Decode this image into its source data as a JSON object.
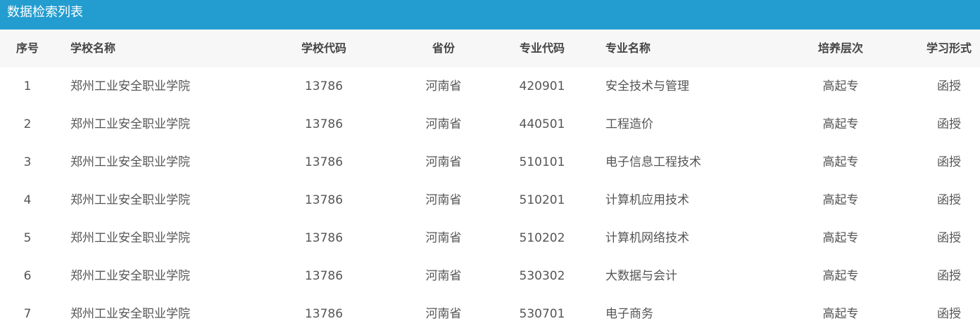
{
  "panel": {
    "title": "数据检索列表"
  },
  "table": {
    "headers": {
      "idx": "序号",
      "school_name": "学校名称",
      "school_code": "学校代码",
      "province": "省份",
      "major_code": "专业代码",
      "major_name": "专业名称",
      "level": "培养层次",
      "study_form": "学习形式"
    },
    "rows": [
      {
        "idx": "1",
        "school_name": "郑州工业安全职业学院",
        "school_code": "13786",
        "province": "河南省",
        "major_code": "420901",
        "major_name": "安全技术与管理",
        "level": "高起专",
        "study_form": "函授"
      },
      {
        "idx": "2",
        "school_name": "郑州工业安全职业学院",
        "school_code": "13786",
        "province": "河南省",
        "major_code": "440501",
        "major_name": "工程造价",
        "level": "高起专",
        "study_form": "函授"
      },
      {
        "idx": "3",
        "school_name": "郑州工业安全职业学院",
        "school_code": "13786",
        "province": "河南省",
        "major_code": "510101",
        "major_name": "电子信息工程技术",
        "level": "高起专",
        "study_form": "函授"
      },
      {
        "idx": "4",
        "school_name": "郑州工业安全职业学院",
        "school_code": "13786",
        "province": "河南省",
        "major_code": "510201",
        "major_name": "计算机应用技术",
        "level": "高起专",
        "study_form": "函授"
      },
      {
        "idx": "5",
        "school_name": "郑州工业安全职业学院",
        "school_code": "13786",
        "province": "河南省",
        "major_code": "510202",
        "major_name": "计算机网络技术",
        "level": "高起专",
        "study_form": "函授"
      },
      {
        "idx": "6",
        "school_name": "郑州工业安全职业学院",
        "school_code": "13786",
        "province": "河南省",
        "major_code": "530302",
        "major_name": "大数据与会计",
        "level": "高起专",
        "study_form": "函授"
      },
      {
        "idx": "7",
        "school_name": "郑州工业安全职业学院",
        "school_code": "13786",
        "province": "河南省",
        "major_code": "530701",
        "major_name": "电子商务",
        "level": "高起专",
        "study_form": "函授"
      }
    ]
  },
  "colors": {
    "header_bar": "#239dd0",
    "table_head_bg": "#f7f7f7",
    "text": "#555555"
  }
}
